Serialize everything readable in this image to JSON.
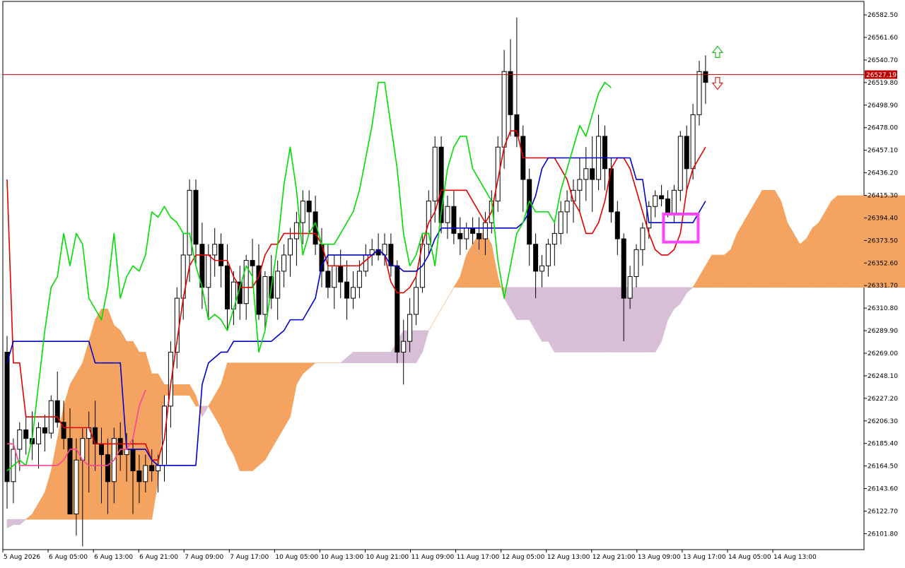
{
  "chart_data": {
    "type": "candlestick",
    "indicator": "Ichimoku Kinko Hyo",
    "y_ticks": [
      "26582.50",
      "26561.60",
      "26540.70",
      "26519.80",
      "26498.90",
      "26478.00",
      "26457.10",
      "26436.20",
      "26415.30",
      "26394.40",
      "26373.50",
      "26352.60",
      "26331.70",
      "26310.80",
      "26289.90",
      "26269.00",
      "26248.10",
      "26227.20",
      "26206.30",
      "26185.40",
      "26164.50",
      "26143.60",
      "26122.70",
      "26101.80"
    ],
    "x_ticks": [
      "5 Aug 2026",
      "6 Aug 05:00",
      "6 Aug 13:00",
      "6 Aug 21:00",
      "7 Aug 09:00",
      "7 Aug 17:00",
      "10 Aug 05:00",
      "10 Aug 13:00",
      "10 Aug 21:00",
      "11 Aug 09:00",
      "11 Aug 17:00",
      "12 Aug 05:00",
      "12 Aug 13:00",
      "12 Aug 21:00",
      "13 Aug 09:00",
      "13 Aug 17:00",
      "14 Aug 05:00",
      "14 Aug 13:00"
    ],
    "ylim": [
      26087.0,
      26595.0
    ],
    "current_price": 26527.19,
    "current_price_label": "26527.19",
    "candles_ohlc": [
      [
        26270,
        26285,
        26125,
        26150
      ],
      [
        26150,
        26190,
        26130,
        26180
      ],
      [
        26180,
        26205,
        26160,
        26198
      ],
      [
        26198,
        26212,
        26175,
        26190
      ],
      [
        26190,
        26215,
        26170,
        26185
      ],
      [
        26185,
        26205,
        26162,
        26200
      ],
      [
        26200,
        26212,
        26178,
        26195
      ],
      [
        26195,
        26230,
        26190,
        26225
      ],
      [
        26225,
        26252,
        26200,
        26205
      ],
      [
        26205,
        26225,
        26180,
        26190
      ],
      [
        26190,
        26218,
        26130,
        26120
      ],
      [
        26120,
        26190,
        26100,
        26170
      ],
      [
        26170,
        26200,
        26090,
        26190
      ],
      [
        26190,
        26215,
        26140,
        26200
      ],
      [
        26200,
        26225,
        26160,
        26185
      ],
      [
        26185,
        26200,
        26130,
        26175
      ],
      [
        26175,
        26190,
        26120,
        26150
      ],
      [
        26150,
        26200,
        26130,
        26190
      ],
      [
        26190,
        26205,
        26160,
        26175
      ],
      [
        26175,
        26195,
        26150,
        26180
      ],
      [
        26180,
        26190,
        26120,
        26160
      ],
      [
        26160,
        26175,
        26130,
        26150
      ],
      [
        26150,
        26175,
        26140,
        26165
      ],
      [
        26165,
        26180,
        26150,
        26160
      ],
      [
        26160,
        26175,
        26140,
        26165
      ],
      [
        26165,
        26230,
        26150,
        26220
      ],
      [
        26220,
        26280,
        26200,
        26270
      ],
      [
        26270,
        26330,
        26255,
        26320
      ],
      [
        26320,
        26380,
        26300,
        26360
      ],
      [
        26360,
        26430,
        26335,
        26420
      ],
      [
        26420,
        26430,
        26350,
        26370
      ],
      [
        26370,
        26390,
        26310,
        26330
      ],
      [
        26330,
        26370,
        26300,
        26360
      ],
      [
        26360,
        26385,
        26340,
        26370
      ],
      [
        26370,
        26380,
        26330,
        26350
      ],
      [
        26350,
        26370,
        26290,
        26310
      ],
      [
        26310,
        26345,
        26295,
        26335
      ],
      [
        26335,
        26350,
        26300,
        26315
      ],
      [
        26315,
        26360,
        26300,
        26355
      ],
      [
        26355,
        26375,
        26330,
        26350
      ],
      [
        26350,
        26370,
        26300,
        26305
      ],
      [
        26305,
        26345,
        26290,
        26340
      ],
      [
        26340,
        26360,
        26310,
        26320
      ],
      [
        26320,
        26355,
        26300,
        26345
      ],
      [
        26345,
        26370,
        26330,
        26360
      ],
      [
        26360,
        26385,
        26340,
        26375
      ],
      [
        26375,
        26400,
        26350,
        26390
      ],
      [
        26390,
        26420,
        26370,
        26410
      ],
      [
        26410,
        26420,
        26380,
        26400
      ],
      [
        26400,
        26415,
        26360,
        26370
      ],
      [
        26370,
        26385,
        26330,
        26345
      ],
      [
        26345,
        26370,
        26320,
        26330
      ],
      [
        26330,
        26360,
        26310,
        26350
      ],
      [
        26350,
        26365,
        26320,
        26335
      ],
      [
        26335,
        26355,
        26300,
        26320
      ],
      [
        26320,
        26345,
        26310,
        26330
      ],
      [
        26330,
        26355,
        26320,
        26345
      ],
      [
        26345,
        26370,
        26340,
        26360
      ],
      [
        26360,
        26375,
        26350,
        26365
      ],
      [
        26365,
        26380,
        26355,
        26360
      ],
      [
        26360,
        26380,
        26350,
        26370
      ],
      [
        26370,
        26380,
        26340,
        26350
      ],
      [
        26350,
        26355,
        26260,
        26270
      ],
      [
        26270,
        26300,
        26240,
        26280
      ],
      [
        26280,
        26320,
        26270,
        26305
      ],
      [
        26305,
        26340,
        26295,
        26330
      ],
      [
        26330,
        26380,
        26325,
        26370
      ],
      [
        26370,
        26420,
        26360,
        26410
      ],
      [
        26410,
        26470,
        26390,
        26460
      ],
      [
        26460,
        26470,
        26380,
        26390
      ],
      [
        26390,
        26415,
        26375,
        26405
      ],
      [
        26405,
        26420,
        26370,
        26380
      ],
      [
        26380,
        26395,
        26360,
        26375
      ],
      [
        26375,
        26390,
        26365,
        26385
      ],
      [
        26385,
        26395,
        26370,
        26380
      ],
      [
        26380,
        26395,
        26365,
        26375
      ],
      [
        26375,
        26400,
        26360,
        26390
      ],
      [
        26390,
        26420,
        26380,
        26410
      ],
      [
        26410,
        26470,
        26400,
        26460
      ],
      [
        26460,
        26550,
        26440,
        26530
      ],
      [
        26530,
        26560,
        26470,
        26490
      ],
      [
        26490,
        26580,
        26460,
        26470
      ],
      [
        26470,
        26480,
        26400,
        26430
      ],
      [
        26430,
        26440,
        26350,
        26370
      ],
      [
        26370,
        26380,
        26320,
        26345
      ],
      [
        26345,
        26360,
        26330,
        26350
      ],
      [
        26350,
        26375,
        26340,
        26370
      ],
      [
        26370,
        26390,
        26350,
        26380
      ],
      [
        26380,
        26410,
        26370,
        26400
      ],
      [
        26400,
        26420,
        26380,
        26410
      ],
      [
        26410,
        26430,
        26390,
        26420
      ],
      [
        26420,
        26450,
        26400,
        26430
      ],
      [
        26430,
        26460,
        26410,
        26440
      ],
      [
        26440,
        26470,
        26400,
        26430
      ],
      [
        26430,
        26490,
        26420,
        26470
      ],
      [
        26470,
        26480,
        26420,
        26440
      ],
      [
        26440,
        26450,
        26390,
        26400
      ],
      [
        26400,
        26410,
        26360,
        26375
      ],
      [
        26375,
        26380,
        26280,
        26320
      ],
      [
        26320,
        26350,
        26310,
        26340
      ],
      [
        26340,
        26370,
        26330,
        26365
      ],
      [
        26365,
        26390,
        26350,
        26385
      ],
      [
        26385,
        26410,
        26375,
        26405
      ],
      [
        26405,
        26420,
        26395,
        26415
      ],
      [
        26415,
        26425,
        26405,
        26412
      ],
      [
        26412,
        26420,
        26395,
        26398
      ],
      [
        26398,
        26425,
        26390,
        26420
      ],
      [
        26420,
        26475,
        26410,
        26470
      ],
      [
        26470,
        26480,
        26420,
        26440
      ],
      [
        26440,
        26500,
        26430,
        26490
      ],
      [
        26490,
        26540,
        26480,
        26530
      ],
      [
        26530,
        26545,
        26500,
        26520
      ]
    ],
    "series": [
      {
        "values": [
          26430,
          26260,
          26260,
          26210,
          26210,
          26210,
          26210,
          26210,
          26210,
          26200,
          26200,
          26200,
          26200,
          26200,
          26185,
          26185,
          26185,
          26185,
          26185,
          26185,
          26185,
          26185,
          26185,
          26170,
          26170,
          26190,
          26240,
          26280,
          26320,
          26350,
          26360,
          26360,
          26360,
          26355,
          26355,
          26355,
          26340,
          26330,
          26330,
          26330,
          26340,
          26360,
          26370,
          26370,
          26380,
          26380,
          26380,
          26380,
          26380,
          26380,
          26370,
          26350,
          26350,
          26350,
          26350,
          26350,
          26350,
          26355,
          26360,
          26365,
          26360,
          26335,
          26325,
          26325,
          26330,
          26340,
          26370,
          26390,
          26400,
          26420,
          26420,
          26420,
          26420,
          26420,
          26410,
          26400,
          26390,
          26400,
          26430,
          26460,
          26475,
          26475,
          26450,
          26450,
          26450,
          26450,
          26450,
          26450,
          26440,
          26430,
          26410,
          26400,
          26380,
          26380,
          26390,
          26410,
          26440,
          26450,
          26450,
          26440,
          26420,
          26400,
          26380,
          26365,
          26360,
          26360,
          26365,
          26380,
          26420,
          26440,
          26450,
          26460
        ],
        "color": "#e00000"
      },
      {
        "values": [
          26260,
          26280,
          26280,
          26280,
          26280,
          26280,
          26280,
          26280,
          26280,
          26280,
          26280,
          26280,
          26280,
          26280,
          26260,
          26260,
          26260,
          26260,
          26260,
          26180,
          26180,
          26180,
          26180,
          26170,
          26165,
          26165,
          26165,
          26165,
          26165,
          26165,
          26165,
          26240,
          26260,
          26265,
          26270,
          26270,
          26280,
          26280,
          26280,
          26280,
          26280,
          26280,
          26280,
          26285,
          26290,
          26300,
          26300,
          26300,
          26310,
          26320,
          26350,
          26360,
          26360,
          26360,
          26360,
          26360,
          26360,
          26360,
          26360,
          26365,
          26360,
          26350,
          26350,
          26345,
          26345,
          26345,
          26350,
          26360,
          26375,
          26385,
          26385,
          26385,
          26385,
          26385,
          26385,
          26385,
          26385,
          26385,
          26385,
          26385,
          26385,
          26385,
          26390,
          26400,
          26415,
          26440,
          26450,
          26450,
          26450,
          26450,
          26450,
          26450,
          26450,
          26450,
          26450,
          26450,
          26450,
          26450,
          26450,
          26450,
          26430,
          26430,
          26390,
          26390,
          26390,
          26390,
          26390,
          26390,
          26390,
          26390,
          26400,
          26410
        ],
        "color": "#0000cc"
      },
      {
        "values": [
          26160,
          26165,
          26170,
          26165,
          26190,
          26240,
          26290,
          26330,
          26340,
          26380,
          26350,
          26380,
          26370,
          26320,
          26310,
          26300,
          26330,
          26380,
          26320,
          26340,
          26350,
          26345,
          26360,
          26400,
          26395,
          26405,
          26395,
          26390,
          26380,
          26380,
          26350,
          26330,
          26300,
          26305,
          26300,
          26290,
          26310,
          26330,
          26350,
          26340,
          26270,
          26290,
          26330,
          26370,
          26425,
          26460,
          26420,
          26360,
          26380,
          26390,
          26370,
          26370,
          26370,
          26380,
          26390,
          26400,
          26420,
          26450,
          26480,
          26520,
          26520,
          26480,
          26440,
          26380,
          26350,
          26360,
          26380,
          26380,
          26350,
          26400,
          26440,
          26460,
          26470,
          26470,
          26440,
          26430,
          26420,
          26410,
          26355,
          26320,
          26350,
          26380,
          26390,
          26410,
          26400,
          26400,
          26400,
          26390,
          26420,
          26440,
          26460,
          26480,
          26470,
          26490,
          26510,
          26520,
          26515
        ],
        "color": "#00dd00"
      },
      {
        "values": [
          26185,
          26185,
          26165,
          26165,
          26165,
          26165,
          26165,
          26165,
          26165,
          26170,
          26180,
          26180,
          26170,
          26165,
          26165,
          26165,
          26165,
          26170,
          26180,
          26180,
          26190,
          26220,
          26235
        ],
        "color": "#ff4499"
      }
    ],
    "kumo_a": [
      26107,
      26110,
      26110,
      26115,
      26120,
      26130,
      26140,
      26160,
      26190,
      26220,
      26240,
      26250,
      26260,
      26280,
      26300,
      26310,
      26310,
      26295,
      26290,
      26280,
      26280,
      26270,
      26270,
      26250,
      26250,
      26240,
      26240,
      26240,
      26240,
      26240,
      26230,
      26210,
      26220,
      26230,
      26240,
      26260,
      26260,
      26260,
      26260,
      26260,
      26260,
      26260,
      26260,
      26260,
      26260,
      26260,
      26260,
      26260,
      26260,
      26260,
      26260,
      26260,
      26260,
      26260,
      26260,
      26260,
      26260,
      26260,
      26260,
      26260,
      26260,
      26260,
      26260,
      26260,
      26260,
      26260,
      26270,
      26290,
      26300,
      26310,
      26320,
      26330,
      26340,
      26360,
      26370,
      26380,
      26380,
      26370,
      26340,
      26320,
      26310,
      26300,
      26300,
      26300,
      26290,
      26280,
      26280,
      26270,
      26270,
      26270,
      26270,
      26270,
      26270,
      26270,
      26270,
      26270,
      26270,
      26270,
      26270,
      26270,
      26270,
      26270,
      26270,
      26270,
      26280,
      26300,
      26310,
      26315,
      26325,
      26330,
      26340,
      26350,
      26360,
      26360,
      26360,
      26365,
      26380,
      26390,
      26400,
      26410,
      26420,
      26420,
      26420,
      26410,
      26390,
      26380,
      26370,
      26375,
      26385,
      26390,
      26400,
      26410,
      26415,
      26415,
      26415,
      26415,
      26415,
      26415,
      26415,
      26415,
      26415,
      26415,
      26415,
      26415,
      26415,
      26415,
      26415,
      26415,
      26415
    ],
    "kumo_b": [
      26115,
      26115,
      26115,
      26115,
      26115,
      26115,
      26115,
      26115,
      26115,
      26115,
      26115,
      26115,
      26115,
      26115,
      26115,
      26115,
      26115,
      26115,
      26115,
      26115,
      26115,
      26115,
      26115,
      26115,
      26150,
      26230,
      26230,
      26230,
      26230,
      26230,
      26220,
      26220,
      26220,
      26210,
      26200,
      26185,
      26175,
      26160,
      26160,
      26160,
      26165,
      26170,
      26180,
      26190,
      26200,
      26210,
      26240,
      26250,
      26255,
      26260,
      26260,
      26260,
      26260,
      26260,
      26265,
      26270,
      26270,
      26270,
      26270,
      26270,
      26270,
      26270,
      26280,
      26290,
      26290,
      26290,
      26290,
      26290,
      26300,
      26310,
      26320,
      26330,
      26330,
      26330,
      26330,
      26330,
      26330,
      26330,
      26330,
      26330,
      26330,
      26330,
      26330,
      26330,
      26330,
      26330,
      26330,
      26330,
      26330,
      26330,
      26330,
      26330,
      26330,
      26330,
      26330,
      26330,
      26330,
      26330,
      26330,
      26330,
      26330,
      26330,
      26330,
      26330,
      26330,
      26330,
      26330,
      26330,
      26330,
      26330,
      26330,
      26330,
      26330,
      26330,
      26330,
      26330,
      26330,
      26330,
      26330,
      26330,
      26330,
      26330,
      26330,
      26330,
      26330,
      26330,
      26330,
      26330,
      26330,
      26330,
      26330,
      26330,
      26330,
      26330,
      26330,
      26330,
      26330,
      26330,
      26330,
      26330,
      26330,
      26330,
      26330,
      26330,
      26330,
      26330,
      26330,
      26330,
      26330
    ],
    "kumo_colors": {
      "bullish": "#f4a460",
      "bearish": "#d8bfd8"
    },
    "grid": false,
    "highlight_box_color": "#ff44ff"
  }
}
